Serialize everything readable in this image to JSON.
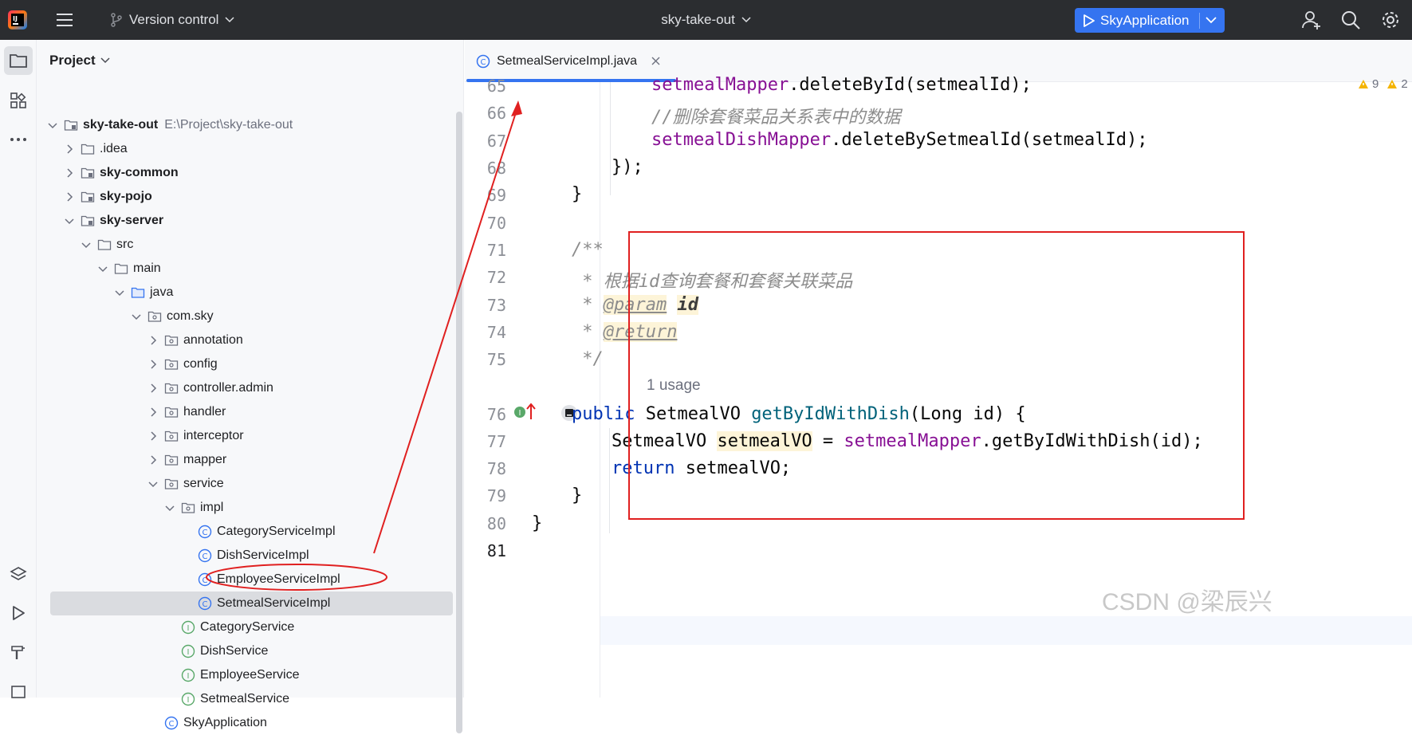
{
  "titlebar": {
    "vcs_label": "Version control",
    "project_name": "sky-take-out",
    "run_config": "SkyApplication"
  },
  "project_panel": {
    "title": "Project",
    "tree": [
      {
        "label": "sky-take-out",
        "path": "E:\\Project\\sky-take-out",
        "depth": 0,
        "expanded": true,
        "icon": "module-folder-icon",
        "bold": true
      },
      {
        "label": ".idea",
        "depth": 1,
        "expanded": false,
        "icon": "folder-icon"
      },
      {
        "label": "sky-common",
        "depth": 1,
        "expanded": false,
        "icon": "module-folder-icon",
        "bold": true
      },
      {
        "label": "sky-pojo",
        "depth": 1,
        "expanded": false,
        "icon": "module-folder-icon",
        "bold": true
      },
      {
        "label": "sky-server",
        "depth": 1,
        "expanded": true,
        "icon": "module-folder-icon",
        "bold": true
      },
      {
        "label": "src",
        "depth": 2,
        "expanded": true,
        "icon": "folder-icon"
      },
      {
        "label": "main",
        "depth": 3,
        "expanded": true,
        "icon": "folder-icon"
      },
      {
        "label": "java",
        "depth": 4,
        "expanded": true,
        "icon": "source-folder-icon"
      },
      {
        "label": "com.sky",
        "depth": 5,
        "expanded": true,
        "icon": "package-icon"
      },
      {
        "label": "annotation",
        "depth": 6,
        "expanded": false,
        "icon": "package-icon"
      },
      {
        "label": "config",
        "depth": 6,
        "expanded": false,
        "icon": "package-icon"
      },
      {
        "label": "controller.admin",
        "depth": 6,
        "expanded": false,
        "icon": "package-icon"
      },
      {
        "label": "handler",
        "depth": 6,
        "expanded": false,
        "icon": "package-icon"
      },
      {
        "label": "interceptor",
        "depth": 6,
        "expanded": false,
        "icon": "package-icon"
      },
      {
        "label": "mapper",
        "depth": 6,
        "expanded": false,
        "icon": "package-icon"
      },
      {
        "label": "service",
        "depth": 6,
        "expanded": true,
        "icon": "package-icon"
      },
      {
        "label": "impl",
        "depth": 7,
        "expanded": true,
        "icon": "package-icon"
      },
      {
        "label": "CategoryServiceImpl",
        "depth": 8,
        "icon": "class-icon"
      },
      {
        "label": "DishServiceImpl",
        "depth": 8,
        "icon": "class-icon"
      },
      {
        "label": "EmployeeServiceImpl",
        "depth": 8,
        "icon": "class-icon"
      },
      {
        "label": "SetmealServiceImpl",
        "depth": 8,
        "icon": "class-icon",
        "selected": true
      },
      {
        "label": "CategoryService",
        "depth": 7,
        "icon": "interface-icon"
      },
      {
        "label": "DishService",
        "depth": 7,
        "icon": "interface-icon"
      },
      {
        "label": "EmployeeService",
        "depth": 7,
        "icon": "interface-icon"
      },
      {
        "label": "SetmealService",
        "depth": 7,
        "icon": "interface-icon"
      },
      {
        "label": "SkyApplication",
        "depth": 6,
        "icon": "class-icon"
      }
    ]
  },
  "editor": {
    "tab_label": "SetmealServiceImpl.java",
    "warnings": {
      "weak": "9",
      "strong": "2"
    },
    "line_numbers": [
      "65",
      "66",
      "67",
      "68",
      "69",
      "70",
      "71",
      "72",
      "73",
      "74",
      "75",
      "76",
      "77",
      "78",
      "79",
      "80",
      "81"
    ],
    "usage_hint": "1 usage",
    "code": {
      "l65_field": "setmealMapper",
      "l65_rest": ".deleteById(setmealId);",
      "l66_comment": "//删除套餐菜品关系表中的数据",
      "l67_field": "setmealDishMapper",
      "l67_rest": ".deleteBySetmealId(setmealId);",
      "l68": "});",
      "l69": "}",
      "l71": "/**",
      "l72": " * 根据id查询套餐和套餐关联菜品",
      "l73_star": " * ",
      "l73_tag": "@param",
      "l73_name": "id",
      "l74_star": " * ",
      "l74_tag": "@return",
      "l75": " */",
      "l76_kw": "public",
      "l76_type": " SetmealVO ",
      "l76_method": "getByIdWithDish",
      "l76_rest": "(Long id) {",
      "l77_type": "SetmealVO ",
      "l77_var": "setmealVO",
      "l77_eq": " = ",
      "l77_field": "setmealMapper",
      "l77_rest": ".getByIdWithDish(id);",
      "l78_kw": "return",
      "l78_rest": " setmealVO;",
      "l79": "}",
      "l80": "}"
    }
  },
  "watermark": "CSDN @梁辰兴",
  "colors": {
    "accent": "#3574f0",
    "annotation_red": "#e02020"
  }
}
